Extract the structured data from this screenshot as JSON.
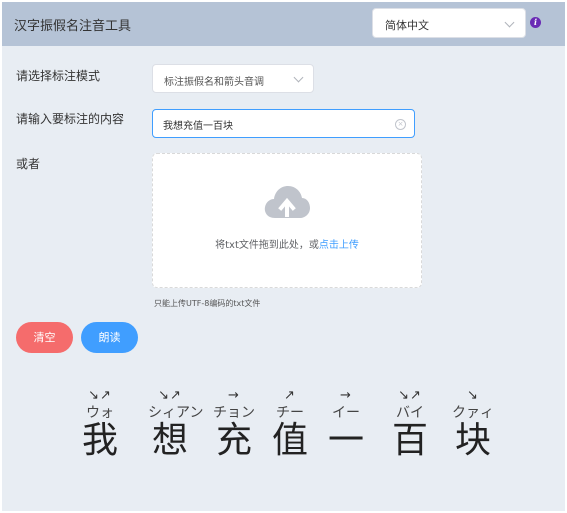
{
  "header": {
    "title": "汉字振假名注音工具",
    "language_select": "简体中文",
    "info_icon": "info-circle-icon",
    "info_glyph": "i"
  },
  "form": {
    "mode_label": "请选择标注模式",
    "mode_value": "标注振假名和箭头音调",
    "content_label": "请输入要标注的内容",
    "content_value": "我想充值一百块",
    "or_label": "或者",
    "upload_text": "将txt文件拖到此处，或",
    "upload_link": "点击上传",
    "upload_icon": "cloud-upload-icon",
    "upload_tip": "只能上传UTF-8编码的txt文件"
  },
  "buttons": {
    "clear": "清空",
    "read": "朗读"
  },
  "result": [
    {
      "han": "我",
      "kana": "ウォ",
      "tone": "↘↗"
    },
    {
      "han": "想",
      "kana": "シィアン",
      "tone": "↘↗"
    },
    {
      "han": "充",
      "kana": "チョン",
      "tone": "→"
    },
    {
      "han": "值",
      "kana": "チー",
      "tone": "↗"
    },
    {
      "han": "一",
      "kana": "イー",
      "tone": "→"
    },
    {
      "han": "百",
      "kana": "バイ",
      "tone": "↘↗"
    },
    {
      "han": "块",
      "kana": "クァィ",
      "tone": "↘"
    }
  ],
  "colors": {
    "header_bg": "#b5c3d6",
    "page_bg": "#e8edf3",
    "accent": "#409eff",
    "danger": "#f56c6c"
  }
}
